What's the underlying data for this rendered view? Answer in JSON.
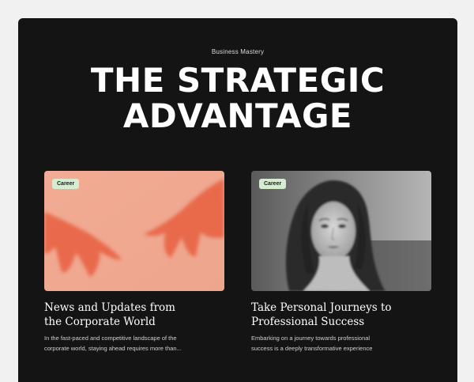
{
  "hero": {
    "eyebrow": "Business Mastery",
    "title_line1": "THE STRATEGIC",
    "title_line2": "ADVANTAGE"
  },
  "cards": [
    {
      "badge": "Career",
      "title_line1": "News and Updates from",
      "title_line2": "the Corporate World",
      "desc_line1": "In the fast-paced and competitive landscape of the",
      "desc_line2": "corporate world, staying ahead requires more than..."
    },
    {
      "badge": "Career",
      "title_line1": "Take Personal Journeys to",
      "title_line2": "Professional Success",
      "desc_line1": "Embarking on a journey towards professional",
      "desc_line2": "success is a deeply transformative experience"
    }
  ]
}
